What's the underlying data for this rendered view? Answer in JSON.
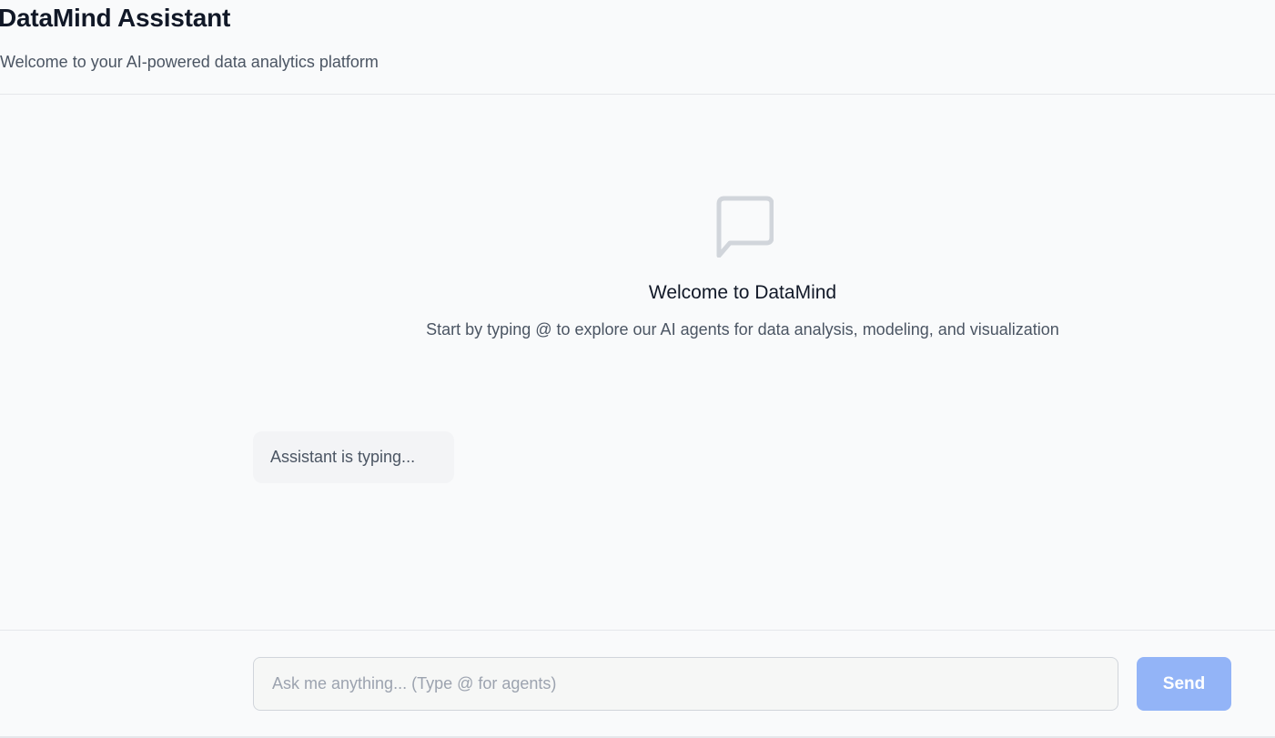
{
  "header": {
    "title": "DataMind Assistant",
    "subtitle": "Welcome to your AI-powered data analytics platform"
  },
  "empty_state": {
    "icon": "chat-bubble-icon",
    "title": "Welcome to DataMind",
    "text": "Start by typing @ to explore our AI agents for data analysis, modeling, and visualization"
  },
  "typing_indicator": {
    "text": "Assistant is typing..."
  },
  "composer": {
    "input_value": "",
    "placeholder": "Ask me anything... (Type @ for agents)",
    "send_label": "Send"
  },
  "colors": {
    "background": "#f9fafb",
    "send_button_disabled": "#93b4f7",
    "icon_gray": "#d1d5db"
  }
}
